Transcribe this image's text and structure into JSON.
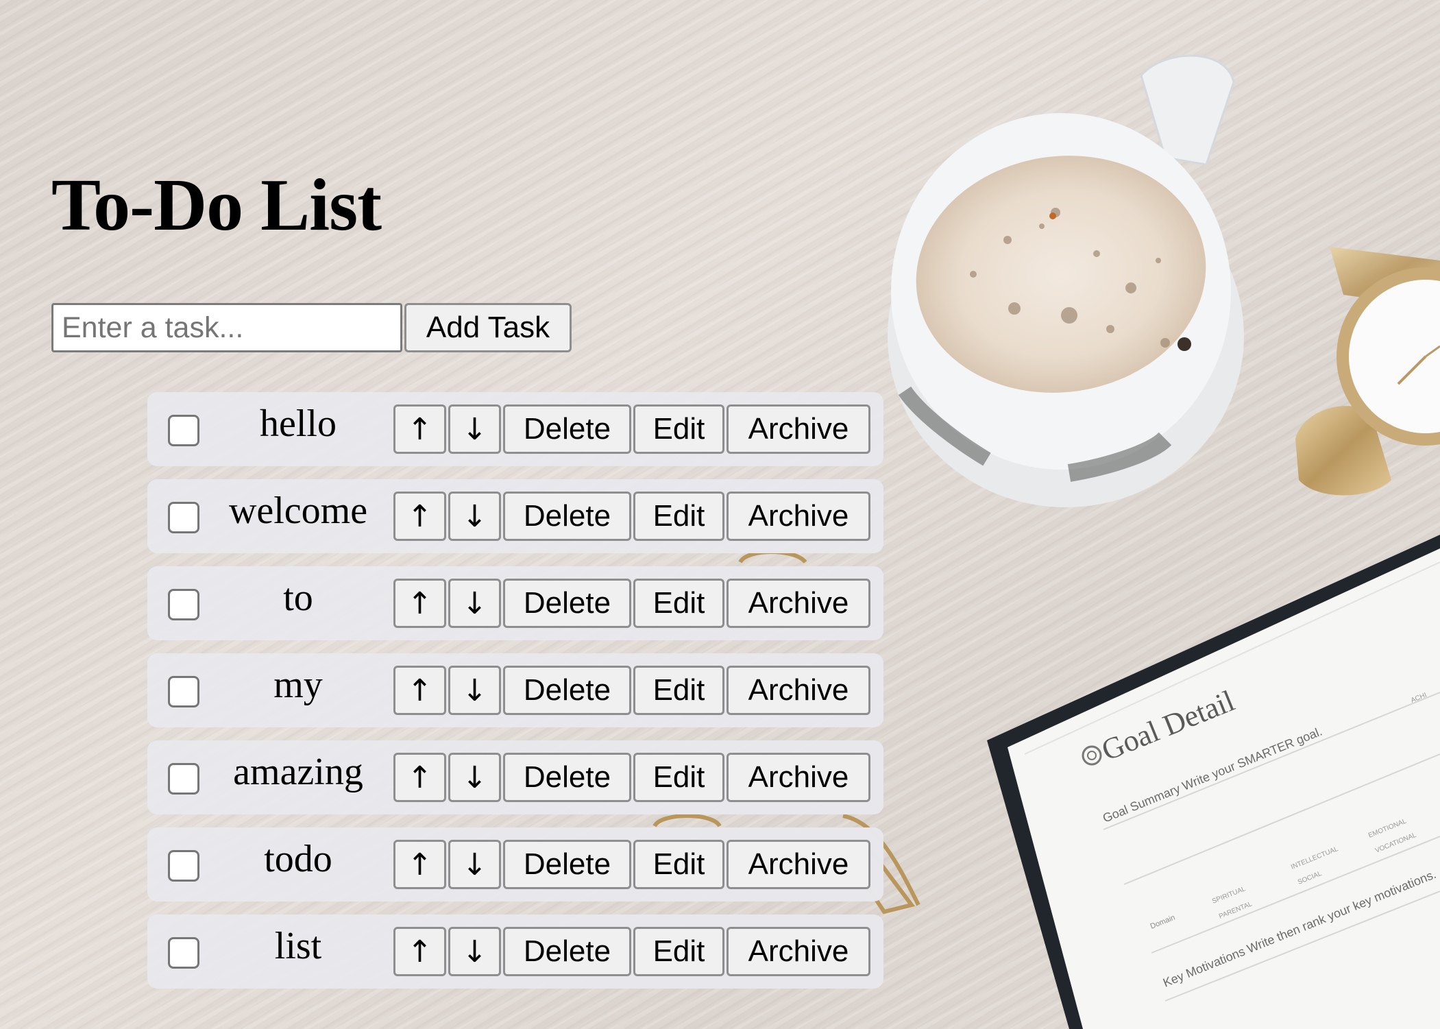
{
  "page": {
    "title": "To-Do List"
  },
  "form": {
    "input_placeholder": "Enter a task...",
    "input_value": "",
    "add_label": "Add Task"
  },
  "row_buttons": {
    "up_label": "↑",
    "down_label": "↓",
    "delete_label": "Delete",
    "edit_label": "Edit",
    "archive_label": "Archive"
  },
  "tasks": [
    {
      "text": "hello",
      "checked": false
    },
    {
      "text": "welcome",
      "checked": false
    },
    {
      "text": "to",
      "checked": false
    },
    {
      "text": "my",
      "checked": false
    },
    {
      "text": "amazing",
      "checked": false
    },
    {
      "text": "todo",
      "checked": false
    },
    {
      "text": "list",
      "checked": false
    }
  ],
  "background": {
    "notebook": {
      "heading": "Goal Detail",
      "lines": [
        "Goal Summary  Write your SMARTER goal.",
        "Domain",
        "Key Motivations  Write then rank your key motivations."
      ],
      "checkboxes": [
        "SPIRITUAL",
        "PARENTAL",
        "INTELLECTUAL",
        "SOCIAL",
        "EMOTIONAL",
        "VOCATIONAL",
        "ACHI"
      ]
    }
  }
}
